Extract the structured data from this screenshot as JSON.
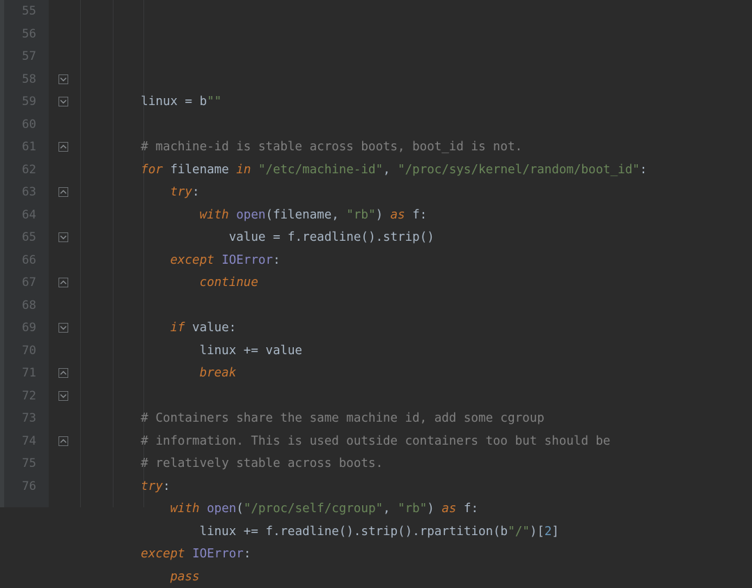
{
  "editor": {
    "first_line": 55,
    "line_count": 22,
    "indent_unit": 4,
    "fold_markers": [
      {
        "line": 58,
        "kind": "open"
      },
      {
        "line": 59,
        "kind": "open"
      },
      {
        "line": 61,
        "kind": "close"
      },
      {
        "line": 63,
        "kind": "close"
      },
      {
        "line": 65,
        "kind": "open"
      },
      {
        "line": 67,
        "kind": "close"
      },
      {
        "line": 69,
        "kind": "open"
      },
      {
        "line": 71,
        "kind": "close"
      },
      {
        "line": 72,
        "kind": "open"
      },
      {
        "line": 74,
        "kind": "close"
      }
    ],
    "lines": [
      {
        "n": 55,
        "indent": 2,
        "tokens": [
          {
            "t": "linux ",
            "c": "tk-ident"
          },
          {
            "t": "= ",
            "c": "tk-op"
          },
          {
            "t": "b",
            "c": "tk-ident"
          },
          {
            "t": "\"\"",
            "c": "tk-str"
          }
        ]
      },
      {
        "n": 56,
        "indent": 0,
        "tokens": []
      },
      {
        "n": 57,
        "indent": 2,
        "tokens": [
          {
            "t": "# machine-id is stable across boots, boot_id is not.",
            "c": "tk-comment"
          }
        ]
      },
      {
        "n": 58,
        "indent": 2,
        "tokens": [
          {
            "t": "for ",
            "c": "tk-kw"
          },
          {
            "t": "filename ",
            "c": "tk-ident"
          },
          {
            "t": "in ",
            "c": "tk-kw"
          },
          {
            "t": "\"/etc/machine-id\"",
            "c": "tk-str"
          },
          {
            "t": ", ",
            "c": "tk-punc"
          },
          {
            "t": "\"/proc/sys/kernel/random/boot_id\"",
            "c": "tk-str"
          },
          {
            "t": ":",
            "c": "tk-punc"
          }
        ]
      },
      {
        "n": 59,
        "indent": 3,
        "tokens": [
          {
            "t": "try",
            "c": "tk-kw"
          },
          {
            "t": ":",
            "c": "tk-punc"
          }
        ]
      },
      {
        "n": 60,
        "indent": 4,
        "tokens": [
          {
            "t": "with ",
            "c": "tk-kw"
          },
          {
            "t": "open",
            "c": "tk-builtin"
          },
          {
            "t": "(",
            "c": "tk-punc"
          },
          {
            "t": "filename",
            "c": "tk-ident"
          },
          {
            "t": ", ",
            "c": "tk-punc"
          },
          {
            "t": "\"rb\"",
            "c": "tk-str"
          },
          {
            "t": ") ",
            "c": "tk-punc"
          },
          {
            "t": "as ",
            "c": "tk-kw"
          },
          {
            "t": "f",
            "c": "tk-ident"
          },
          {
            "t": ":",
            "c": "tk-punc"
          }
        ]
      },
      {
        "n": 61,
        "indent": 5,
        "tokens": [
          {
            "t": "value ",
            "c": "tk-ident"
          },
          {
            "t": "= ",
            "c": "tk-op"
          },
          {
            "t": "f",
            "c": "tk-ident"
          },
          {
            "t": ".",
            "c": "tk-punc"
          },
          {
            "t": "readline",
            "c": "tk-ident"
          },
          {
            "t": "()",
            "c": "tk-punc"
          },
          {
            "t": ".",
            "c": "tk-punc"
          },
          {
            "t": "strip",
            "c": "tk-ident"
          },
          {
            "t": "()",
            "c": "tk-punc"
          }
        ]
      },
      {
        "n": 62,
        "indent": 3,
        "tokens": [
          {
            "t": "except ",
            "c": "tk-kw"
          },
          {
            "t": "IOError",
            "c": "tk-builtin"
          },
          {
            "t": ":",
            "c": "tk-punc"
          }
        ]
      },
      {
        "n": 63,
        "indent": 4,
        "tokens": [
          {
            "t": "continue",
            "c": "tk-kw"
          }
        ]
      },
      {
        "n": 64,
        "indent": 0,
        "tokens": []
      },
      {
        "n": 65,
        "indent": 3,
        "tokens": [
          {
            "t": "if ",
            "c": "tk-kw"
          },
          {
            "t": "value",
            "c": "tk-ident"
          },
          {
            "t": ":",
            "c": "tk-punc"
          }
        ]
      },
      {
        "n": 66,
        "indent": 4,
        "tokens": [
          {
            "t": "linux ",
            "c": "tk-ident"
          },
          {
            "t": "+= ",
            "c": "tk-op"
          },
          {
            "t": "value",
            "c": "tk-ident"
          }
        ]
      },
      {
        "n": 67,
        "indent": 4,
        "tokens": [
          {
            "t": "break",
            "c": "tk-kw"
          }
        ]
      },
      {
        "n": 68,
        "indent": 0,
        "tokens": []
      },
      {
        "n": 69,
        "indent": 2,
        "tokens": [
          {
            "t": "# Containers share the same machine id, add some cgroup",
            "c": "tk-comment"
          }
        ]
      },
      {
        "n": 70,
        "indent": 2,
        "tokens": [
          {
            "t": "# information. This is used outside containers too but should be",
            "c": "tk-comment"
          }
        ]
      },
      {
        "n": 71,
        "indent": 2,
        "tokens": [
          {
            "t": "# relatively stable across boots.",
            "c": "tk-comment"
          }
        ]
      },
      {
        "n": 72,
        "indent": 2,
        "tokens": [
          {
            "t": "try",
            "c": "tk-kw"
          },
          {
            "t": ":",
            "c": "tk-punc"
          }
        ]
      },
      {
        "n": 73,
        "indent": 3,
        "tokens": [
          {
            "t": "with ",
            "c": "tk-kw"
          },
          {
            "t": "open",
            "c": "tk-builtin"
          },
          {
            "t": "(",
            "c": "tk-punc"
          },
          {
            "t": "\"/proc/self/cgroup\"",
            "c": "tk-str"
          },
          {
            "t": ", ",
            "c": "tk-punc"
          },
          {
            "t": "\"rb\"",
            "c": "tk-str"
          },
          {
            "t": ") ",
            "c": "tk-punc"
          },
          {
            "t": "as ",
            "c": "tk-kw"
          },
          {
            "t": "f",
            "c": "tk-ident"
          },
          {
            "t": ":",
            "c": "tk-punc"
          }
        ]
      },
      {
        "n": 74,
        "indent": 4,
        "tokens": [
          {
            "t": "linux ",
            "c": "tk-ident"
          },
          {
            "t": "+= ",
            "c": "tk-op"
          },
          {
            "t": "f",
            "c": "tk-ident"
          },
          {
            "t": ".",
            "c": "tk-punc"
          },
          {
            "t": "readline",
            "c": "tk-ident"
          },
          {
            "t": "()",
            "c": "tk-punc"
          },
          {
            "t": ".",
            "c": "tk-punc"
          },
          {
            "t": "strip",
            "c": "tk-ident"
          },
          {
            "t": "()",
            "c": "tk-punc"
          },
          {
            "t": ".",
            "c": "tk-punc"
          },
          {
            "t": "rpartition",
            "c": "tk-ident"
          },
          {
            "t": "(",
            "c": "tk-punc"
          },
          {
            "t": "b",
            "c": "tk-ident"
          },
          {
            "t": "\"/\"",
            "c": "tk-str"
          },
          {
            "t": ")[",
            "c": "tk-punc"
          },
          {
            "t": "2",
            "c": "tk-num"
          },
          {
            "t": "]",
            "c": "tk-punc"
          }
        ]
      },
      {
        "n": 75,
        "indent": 2,
        "tokens": [
          {
            "t": "except ",
            "c": "tk-kw"
          },
          {
            "t": "IOError",
            "c": "tk-builtin"
          },
          {
            "t": ":",
            "c": "tk-punc"
          }
        ]
      },
      {
        "n": 76,
        "indent": 3,
        "tokens": [
          {
            "t": "pass",
            "c": "tk-kw"
          }
        ]
      }
    ]
  }
}
